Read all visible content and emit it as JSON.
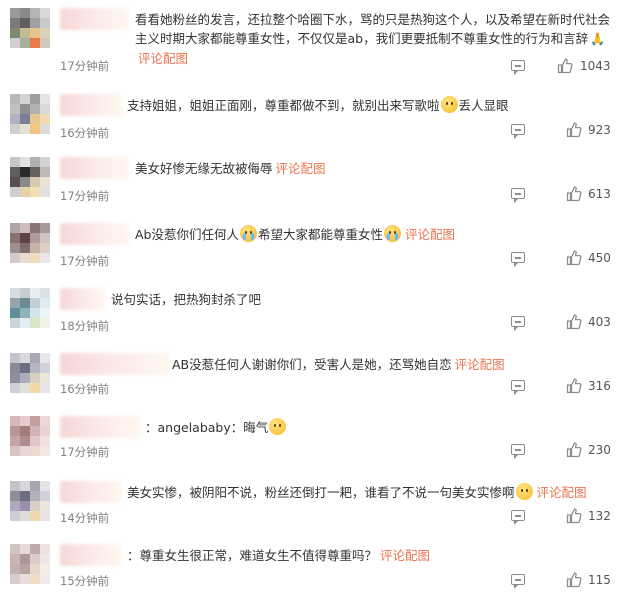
{
  "comments": [
    {
      "id": 1,
      "avatar_colors": [
        "#9a9a9a",
        "#8a8a8a",
        "#b5b5b5",
        "#d8d8d8",
        "#7a7a7a",
        "#5f5f5f",
        "#a0a0a0",
        "#c9c9c9",
        "#7d8a6f",
        "#c4bb92",
        "#e4c48a",
        "#d9d1bd",
        "#cfcfcf",
        "#a8b0a0",
        "#e87a4a",
        "#d0c8b8"
      ],
      "text_before": "看看她粉丝的发言，还拉整个哈圈下水，骂的只是热狗这个人，以及希望在新时代社会主义时期大家都能尊重女性，不仅仅是ab，我们更要抵制不尊重女性的行为和言辞",
      "emoji": "pray",
      "text_after": "",
      "pic_link": "评论配图",
      "time": "17分钟前",
      "likes": "1043",
      "accent_color": "#eb7350"
    },
    {
      "id": 2,
      "avatar_colors": [
        "#b8b8b8",
        "#d2d2d2",
        "#9e9e9e",
        "#e3e3e3",
        "#c0c0c0",
        "#8f8f8f",
        "#b2b2b2",
        "#d9d9d9",
        "#aeb2c4",
        "#7a7f99",
        "#e8c690",
        "#f2dab4",
        "#cfcfcf",
        "#e6e1d5",
        "#f0c882",
        "#dcdcdc"
      ],
      "text_before": "支持姐姐，姐姐正面刚，尊重都做不到，就别出来写歌啦",
      "emoji": "face",
      "text_after": "丢人显眼",
      "pic_link": "",
      "time": "16分钟前",
      "likes": "923"
    },
    {
      "id": 3,
      "avatar_colors": [
        "#c6c6c6",
        "#e1e1e1",
        "#b0b0b0",
        "#d4d4d4",
        "#5f5f5f",
        "#2a2a2a",
        "#6b5e5e",
        "#c0b8b8",
        "#5a4d4d",
        "#8a8a8a",
        "#d6c9b0",
        "#ebe4d4",
        "#cfcfcf",
        "#e3d2a8",
        "#f1dfb4",
        "#e0e0e0"
      ],
      "text_before": "美女好惨无缘无故被侮辱",
      "emoji": "",
      "text_after": "",
      "pic_link": "评论配图",
      "time": "17分钟前",
      "likes": "613"
    },
    {
      "id": 4,
      "avatar_colors": [
        "#b1a6a6",
        "#cdbdbd",
        "#8c7474",
        "#a89a9a",
        "#8b6e6e",
        "#5d4444",
        "#b39a9a",
        "#d0c3c3",
        "#9d8f8f",
        "#7f6d6d",
        "#c8b3a8",
        "#e0cfc4",
        "#d4cccc",
        "#e8dcd3",
        "#f0dcba",
        "#e7e7e7"
      ],
      "text_before": "Ab没惹你们任何人",
      "emoji": "cry",
      "text_after": "希望大家都能尊重女性",
      "emoji2": "cry",
      "pic_link": "评论配图",
      "time": "17分钟前",
      "likes": "450"
    },
    {
      "id": 5,
      "avatar_colors": [
        "#d6dde0",
        "#c4ced2",
        "#e7eef0",
        "#d9e3e6",
        "#94a5ab",
        "#6a8a94",
        "#bfd0d4",
        "#e1ecee",
        "#5f8f9a",
        "#8fb3bb",
        "#d3e5e8",
        "#eef5f6",
        "#c9d7da",
        "#e3ecee",
        "#d9e6c6",
        "#eef3e6"
      ],
      "text_before": "说句实话，把热狗封杀了吧",
      "emoji": "",
      "text_after": "",
      "pic_link": "",
      "time": "18分钟前",
      "likes": "403"
    },
    {
      "id": 6,
      "avatar_colors": [
        "#c4c4cc",
        "#d8d8df",
        "#a8a8b4",
        "#e6e6ea",
        "#8a8a9a",
        "#6e6e82",
        "#b4b4c2",
        "#d1d1da",
        "#8f8fa2",
        "#acacbc",
        "#d6d0c0",
        "#ebe6da",
        "#cfcfd6",
        "#e2e0d8",
        "#f0d9a6",
        "#e6e6e6"
      ],
      "text_before": "AB没惹任何人谢谢你们，受害人是她，还骂她自恋",
      "emoji": "",
      "text_after": "",
      "pic_link": "评论配图",
      "time": "16分钟前",
      "likes": "316"
    },
    {
      "id": 7,
      "avatar_colors": [
        "#d6b8b8",
        "#e6cccc",
        "#c49e9e",
        "#ecd8d8",
        "#b89494",
        "#a37d7d",
        "#d2b2b2",
        "#e8d2d2",
        "#c6a4a4",
        "#b08c8c",
        "#e0c6c6",
        "#f0e0e0",
        "#d8c4c4",
        "#e6d6d6",
        "#ecd8cc",
        "#f2e6e6"
      ],
      "text_before": "：angelababy：晦气",
      "emoji": "face",
      "text_after": "",
      "pic_link": "",
      "time": "17分钟前",
      "likes": "230"
    },
    {
      "id": 8,
      "avatar_colors": [
        "#c2c2c8",
        "#d6d6dc",
        "#a6a6b0",
        "#e4e4e8",
        "#8e8e9a",
        "#6c6c7c",
        "#b2b2be",
        "#d0d0d8",
        "#b0a6be",
        "#9a8eac",
        "#d8d0c4",
        "#ece6dc",
        "#cdcdd4",
        "#e0dcd8",
        "#eed8ac",
        "#e4e4e4"
      ],
      "text_before": "美女实惨，被阴阳不说，粉丝还倒打一耙，谁看了不说一句美女实惨啊",
      "emoji": "face",
      "text_after": "",
      "pic_link": "评论配图",
      "time": "14分钟前",
      "likes": "132"
    },
    {
      "id": 9,
      "avatar_colors": [
        "#d2c2c2",
        "#e4d8d8",
        "#bfaaaa",
        "#ece2e2",
        "#c8b6b6",
        "#ad9696",
        "#dccccc",
        "#efe6e6",
        "#c4b2b2",
        "#b8a4a4",
        "#e6d6cc",
        "#f4ece6",
        "#d8cccc",
        "#e8dede",
        "#f0dcc6",
        "#f2eaea"
      ],
      "text_before": "：尊重女生很正常，难道女生不值得尊重吗？",
      "emoji": "",
      "text_after": "",
      "pic_link": "评论配图",
      "time": "15分钟前",
      "likes": "115"
    }
  ],
  "icons": {
    "reply": "comment-reply-icon",
    "like": "thumbs-up-icon"
  }
}
